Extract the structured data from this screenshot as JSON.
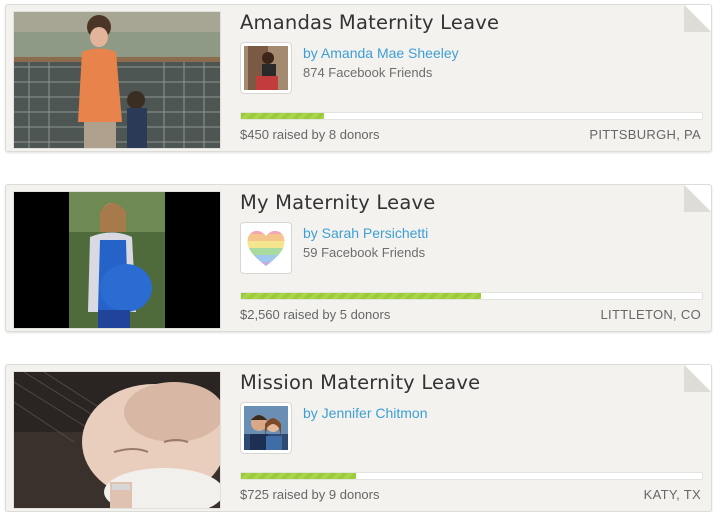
{
  "campaigns": [
    {
      "title": "Amandas Maternity Leave",
      "organizer": "by Amanda Mae Sheeley",
      "friends": "874 Facebook Friends",
      "progress_fraction": 0.18,
      "raised": "$450 raised by 8 donors",
      "location": "PITTSBURGH, PA",
      "image": "mother-and-child-at-zoo-photo",
      "avatar": "organizer-photo"
    },
    {
      "title": "My Maternity Leave",
      "organizer": "by Sarah Persichetti",
      "friends": "59 Facebook Friends",
      "progress_fraction": 0.52,
      "raised": "$2,560 raised by 5 donors",
      "location": "LITTLETON, CO",
      "image": "pregnant-woman-photo",
      "avatar": "rainbow-heart-image"
    },
    {
      "title": "Mission Maternity Leave",
      "organizer": "by Jennifer Chitmon",
      "friends": "",
      "progress_fraction": 0.25,
      "raised": "$725 raised by 9 donors",
      "location": "KATY, TX",
      "image": "newborn-baby-photo",
      "avatar": "couple-photo"
    }
  ],
  "colors": {
    "card_bg": "#f3f2ef",
    "link": "#3e9fd3",
    "progress_green": "#9acb3c"
  }
}
